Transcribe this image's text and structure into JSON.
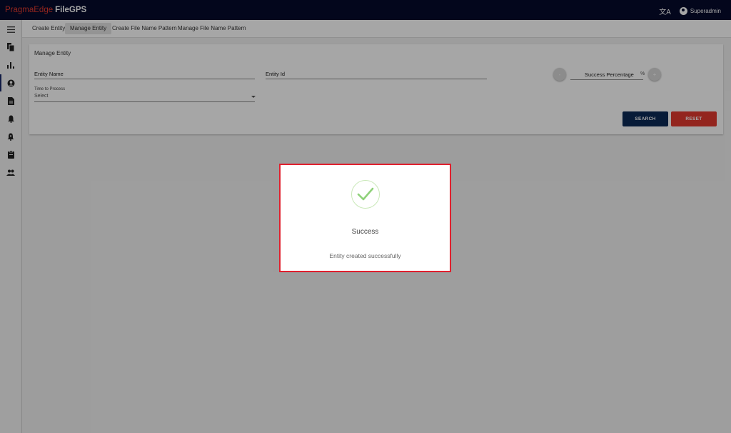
{
  "header": {
    "brand_part1": "PragmaEdge",
    "brand_part2": "FileGPS",
    "user_name": "Superadmin",
    "translate_glyph": "文A"
  },
  "sidebar": {
    "items": [
      {
        "icon": "menu-icon"
      },
      {
        "icon": "files-icon"
      },
      {
        "icon": "bar-chart-icon"
      },
      {
        "icon": "account-circle-icon"
      },
      {
        "icon": "document-icon"
      },
      {
        "icon": "bell-icon"
      },
      {
        "icon": "bell-alert-icon"
      },
      {
        "icon": "clipboard-icon"
      },
      {
        "icon": "people-icon"
      }
    ]
  },
  "tabs": [
    "Create Entity",
    "Manage Entity",
    "Create File Name Pattern",
    "Manage File Name Pattern"
  ],
  "form": {
    "title": "Manage Entity",
    "entity_name_label": "Entity Name",
    "entity_id_label": "Entity Id",
    "time_label": "Time to Process",
    "time_value": "Select",
    "minus_label": "-",
    "plus_label": "+",
    "success_pct_label": "Success Percentage",
    "pct_symbol": "%",
    "search_label": "SEARCH",
    "reset_label": "RESET"
  },
  "dialog": {
    "title": "Success",
    "message": "Entity created successfully"
  },
  "colors": {
    "topbar": "#050a2c",
    "brand_red": "#e23a2e",
    "search_button": "#0b2a57",
    "reset_button": "#e23a2e",
    "check": "#8fd17a",
    "dialog_border": "#e0202e"
  }
}
